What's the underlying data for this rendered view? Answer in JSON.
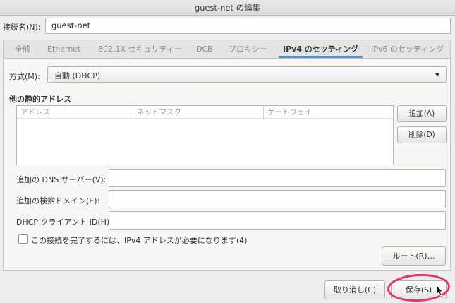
{
  "window": {
    "title": "guest-net の編集"
  },
  "connection_name": {
    "label": "接続名(N):",
    "value": "guest-net"
  },
  "tabs": [
    {
      "label": "全般"
    },
    {
      "label": "Ethernet"
    },
    {
      "label": "802.1X セキュリティー"
    },
    {
      "label": "DCB"
    },
    {
      "label": "プロキシー"
    },
    {
      "label": "IPv4 のセッティング"
    },
    {
      "label": "IPv6 のセッティング"
    }
  ],
  "active_tab": "IPv4 のセッティング",
  "method": {
    "label": "方式(M):",
    "selected": "自動 (DHCP)"
  },
  "static_addresses": {
    "title": "他の静的アドレス",
    "columns": [
      "アドレス",
      "ネットマスク",
      "ゲートウェイ"
    ],
    "add_label": "追加(A)",
    "delete_label": "削除(D)"
  },
  "dns": {
    "label": "追加の DNS サーバー(V):",
    "value": ""
  },
  "search_domains": {
    "label": "追加の検索ドメイン(E):",
    "value": ""
  },
  "dhcp_client_id": {
    "label": "DHCP クライアント ID(H):",
    "value": ""
  },
  "require_ipv4": {
    "label": "この接続を完了するには、IPv4 アドレスが必要になります(4)",
    "checked": false
  },
  "routes_label": "ルート(R)…",
  "cancel_label": "取り消し(C)",
  "save_label": "保存(S)",
  "colors": {
    "accent_tab": "#4a90d9",
    "highlight": "#e9336f"
  },
  "icons": {
    "dropdown": "chevron-down-icon",
    "cursor": "mouse-pointer-icon"
  }
}
